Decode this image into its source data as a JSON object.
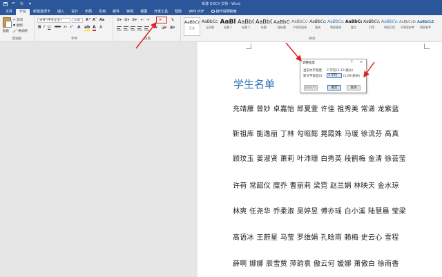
{
  "window": {
    "title": "新建 DOCX 文档 - Word",
    "quick_access": [
      "save-icon",
      "undo-icon",
      "redo-icon",
      "customize-icon"
    ]
  },
  "tabs": [
    {
      "label": "文件",
      "active": false
    },
    {
      "label": "开始",
      "active": true
    },
    {
      "label": "新建选项卡",
      "active": false
    },
    {
      "label": "插入",
      "active": false
    },
    {
      "label": "设计",
      "active": false
    },
    {
      "label": "布局",
      "active": false
    },
    {
      "label": "引用",
      "active": false
    },
    {
      "label": "邮件",
      "active": false
    },
    {
      "label": "审阅",
      "active": false
    },
    {
      "label": "视图",
      "active": false
    },
    {
      "label": "开发工具",
      "active": false
    },
    {
      "label": "帮助",
      "active": false
    },
    {
      "label": "WPS PDF",
      "active": false
    },
    {
      "label": "操作说明搜索",
      "active": false
    }
  ],
  "ribbon": {
    "clipboard": {
      "label": "剪贴板",
      "paste": "粘贴",
      "cut": "剪切",
      "copy": "复制",
      "format_painter": "格式刷"
    },
    "font": {
      "label": "字体",
      "font_name": "宋体 (中文正文)",
      "font_size": "三号"
    },
    "paragraph": {
      "label": "段落"
    },
    "styles": {
      "label": "样式",
      "items": [
        {
          "sample": "AaBbCcDc",
          "name": "正文"
        },
        {
          "sample": "AaBbCcDc",
          "name": "无间隔"
        },
        {
          "sample": "AaBl",
          "name": "标题 1"
        },
        {
          "sample": "AaBbC",
          "name": "标题 2"
        },
        {
          "sample": "AaBbC",
          "name": "标题"
        },
        {
          "sample": "AaBbCcD",
          "name": "副标题"
        },
        {
          "sample": "AaBbCcDc",
          "name": "不明显强调"
        },
        {
          "sample": "AaBbCcDc",
          "name": "强调"
        },
        {
          "sample": "AaBbCcDc",
          "name": "明显强调"
        },
        {
          "sample": "AaBbCcDc",
          "name": "要点"
        },
        {
          "sample": "AaBbCcDc",
          "name": "引用"
        },
        {
          "sample": "AaBbCcDc",
          "name": "明显引用"
        },
        {
          "sample": "AaBbCcDc",
          "name": "不明显参考"
        },
        {
          "sample": "AaBbCcDc",
          "name": "明显参考"
        }
      ]
    },
    "accent_color": "#e02020"
  },
  "document": {
    "heading": "学生名单",
    "lines": [
      "充靖雁  曾妙  卓嘉怡  郎夏萱  许佳  祖秀美  常潇  龙紫蓝",
      "靳祖库  能逸丽  丁林  勾昭懿  晃霞姝  马瑗  徐流芬  高真",
      "顾玟玉  姜淑贤  萧莉  叶沛珊  白秀英  段鹤梅  金清  徐芸莹",
      "许荷  常韶仪  糜乔  曹丽莉  梁霓  赵兰娟  林映天  金水琼",
      "林爽  任尧华  乔柔淑  吴婷昱  傅亦瑶  白小溪  陆慧晨  莹梁",
      "高语冰  王蔚星  马莹  罗维娟  孔晗雨  赖梅  史云心  雪程",
      "薛啊  娜娜  辰雪贾  萍韵袁  傲云何  媛娜  萧傲白  徐雨香"
    ]
  },
  "dialog": {
    "title": "调整宽度",
    "help": "?",
    "close": "×",
    "current_label": "当前文字宽度:",
    "current_value": "2 字符",
    "current_unit": "(1.13 厘米)",
    "new_label": "新文字宽度(I):",
    "new_value": "3 字符",
    "new_unit": "(1.69 厘米)",
    "reset": "删除(R)",
    "ok": "确定",
    "cancel": "取消"
  }
}
